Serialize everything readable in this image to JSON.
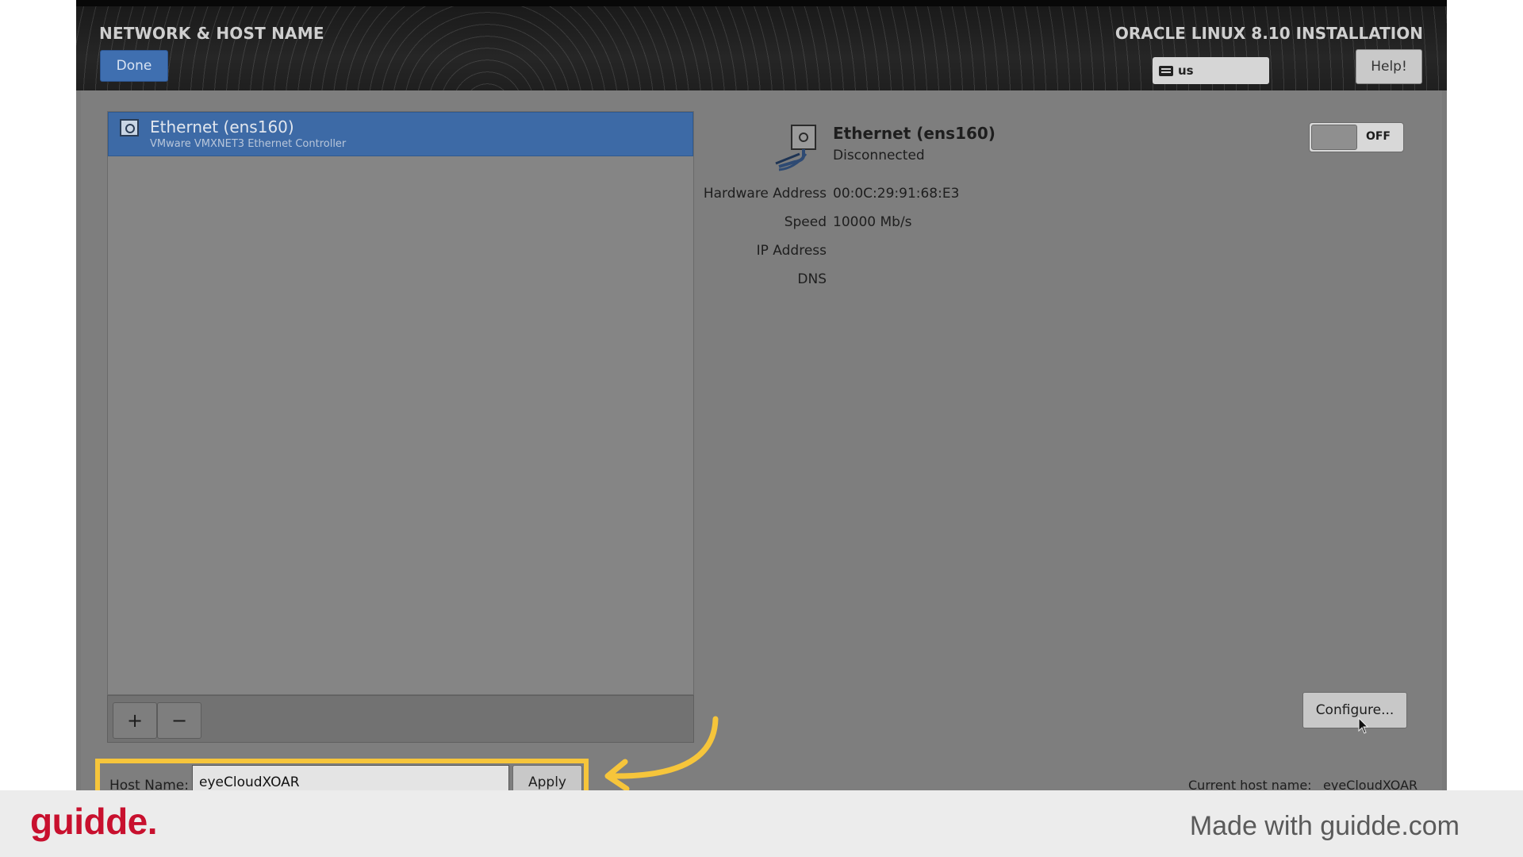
{
  "header": {
    "title": "NETWORK & HOST NAME",
    "product": "ORACLE LINUX 8.10 INSTALLATION",
    "done_label": "Done",
    "keyboard_layout": "us",
    "help_label": "Help!"
  },
  "device_list": {
    "items": [
      {
        "name": "Ethernet (ens160)",
        "description": "VMware VMXNET3 Ethernet Controller",
        "selected": true
      }
    ],
    "add_label": "+",
    "remove_label": "−"
  },
  "device_info": {
    "name": "Ethernet (ens160)",
    "status": "Disconnected",
    "hardware_address_label": "Hardware Address",
    "hardware_address": "00:0C:29:91:68:E3",
    "speed_label": "Speed",
    "speed": "10000 Mb/s",
    "ip_label": "IP Address",
    "dns_label": "DNS",
    "toggle_state": "OFF",
    "configure_label": "Configure..."
  },
  "hostname": {
    "label": "Host Name:",
    "value": "eyeCloudXOAR",
    "apply_label": "Apply",
    "current_label": "Current host name:",
    "current_value": "eyeCloudXOAR"
  },
  "footer": {
    "brand": "guidde.",
    "made_with": "Made with guidde.com"
  },
  "colors": {
    "highlight": "#f6c53b",
    "brand": "#c8102e",
    "selection": "#3d6aa6"
  }
}
